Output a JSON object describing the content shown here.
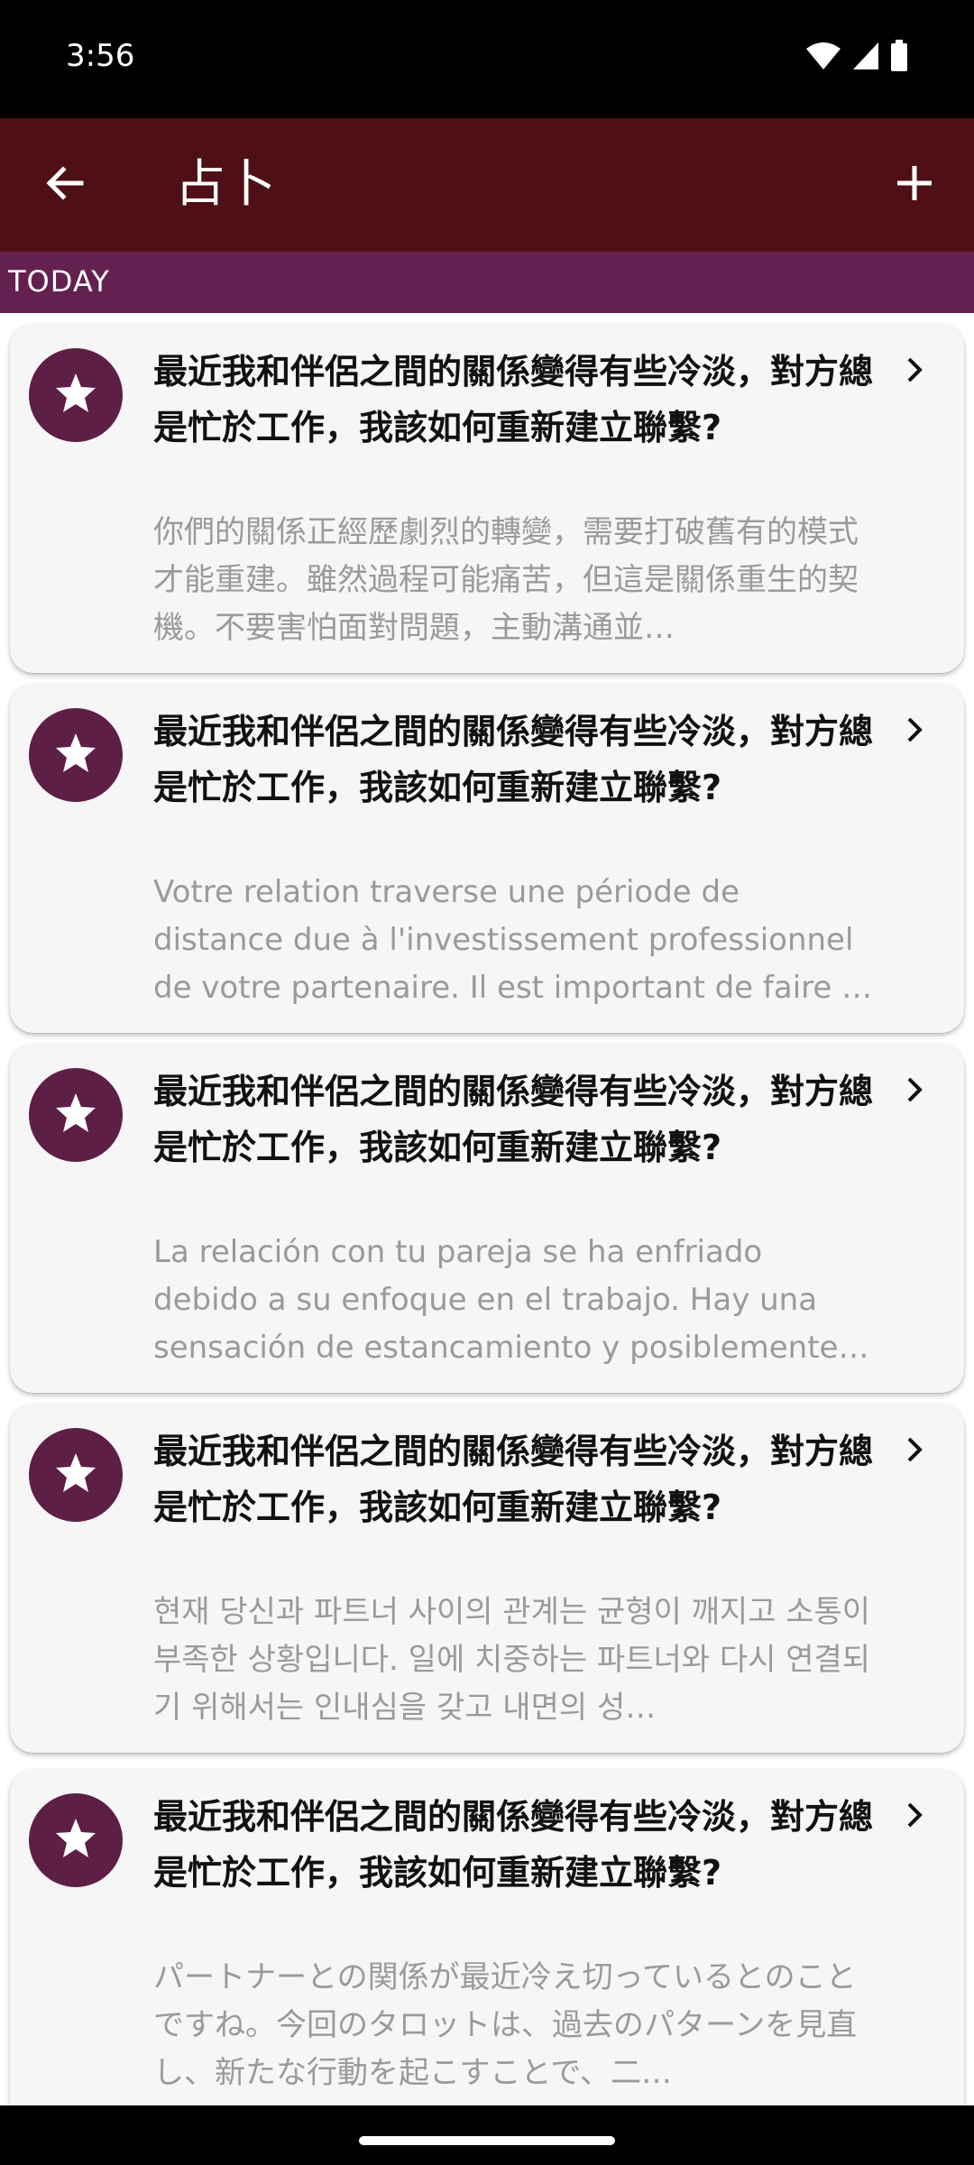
{
  "status_bar": {
    "time": "3:56",
    "icons": [
      "wifi-icon",
      "signal-icon",
      "battery-icon"
    ]
  },
  "app_bar": {
    "title": "占卜",
    "back_icon": "arrow-left-icon",
    "add_icon": "plus-icon",
    "color": "#4f0f16"
  },
  "section": {
    "label": "TODAY",
    "color": "#64214f"
  },
  "cards": [
    {
      "title": "最近我和伴侶之間的關係變得有些冷淡，對方總是忙於工作，我該如何重新建立聯繫?",
      "body": "你們的關係正經歷劇烈的轉變，需要打破舊有的模式才能重建。雖然過程可能痛苦，但這是關係重生的契機。不要害怕面對問題，主動溝通並…",
      "icon": "star-icon"
    },
    {
      "title": "最近我和伴侶之間的關係變得有些冷淡，對方總是忙於工作，我該如何重新建立聯繫?",
      "body": "Votre relation traverse une période de distance due à l'investissement professionnel de votre partenaire. Il est important de faire …",
      "icon": "star-icon"
    },
    {
      "title": "最近我和伴侶之間的關係變得有些冷淡，對方總是忙於工作，我該如何重新建立聯繫?",
      "body": "La relación con tu pareja se ha enfriado debido a su enfoque en el trabajo. Hay una sensación de estancamiento y posiblemente…",
      "icon": "star-icon"
    },
    {
      "title": "最近我和伴侶之間的關係變得有些冷淡，對方總是忙於工作，我該如何重新建立聯繫?",
      "body": "현재 당신과 파트너 사이의 관계는 균형이 깨지고 소통이 부족한 상황입니다. 일에 치중하는 파트너와 다시 연결되기 위해서는 인내심을 갖고 내면의 성…",
      "icon": "star-icon"
    },
    {
      "title": "最近我和伴侶之間的關係變得有些冷淡，對方總是忙於工作，我該如何重新建立聯繫?",
      "body": "パートナーとの関係が最近冷え切っているとのことですね。今回のタロットは、過去のパターンを見直し、新たな行動を起こすことで、二…",
      "icon": "star-icon"
    }
  ],
  "accent_color": "#5d1f46"
}
